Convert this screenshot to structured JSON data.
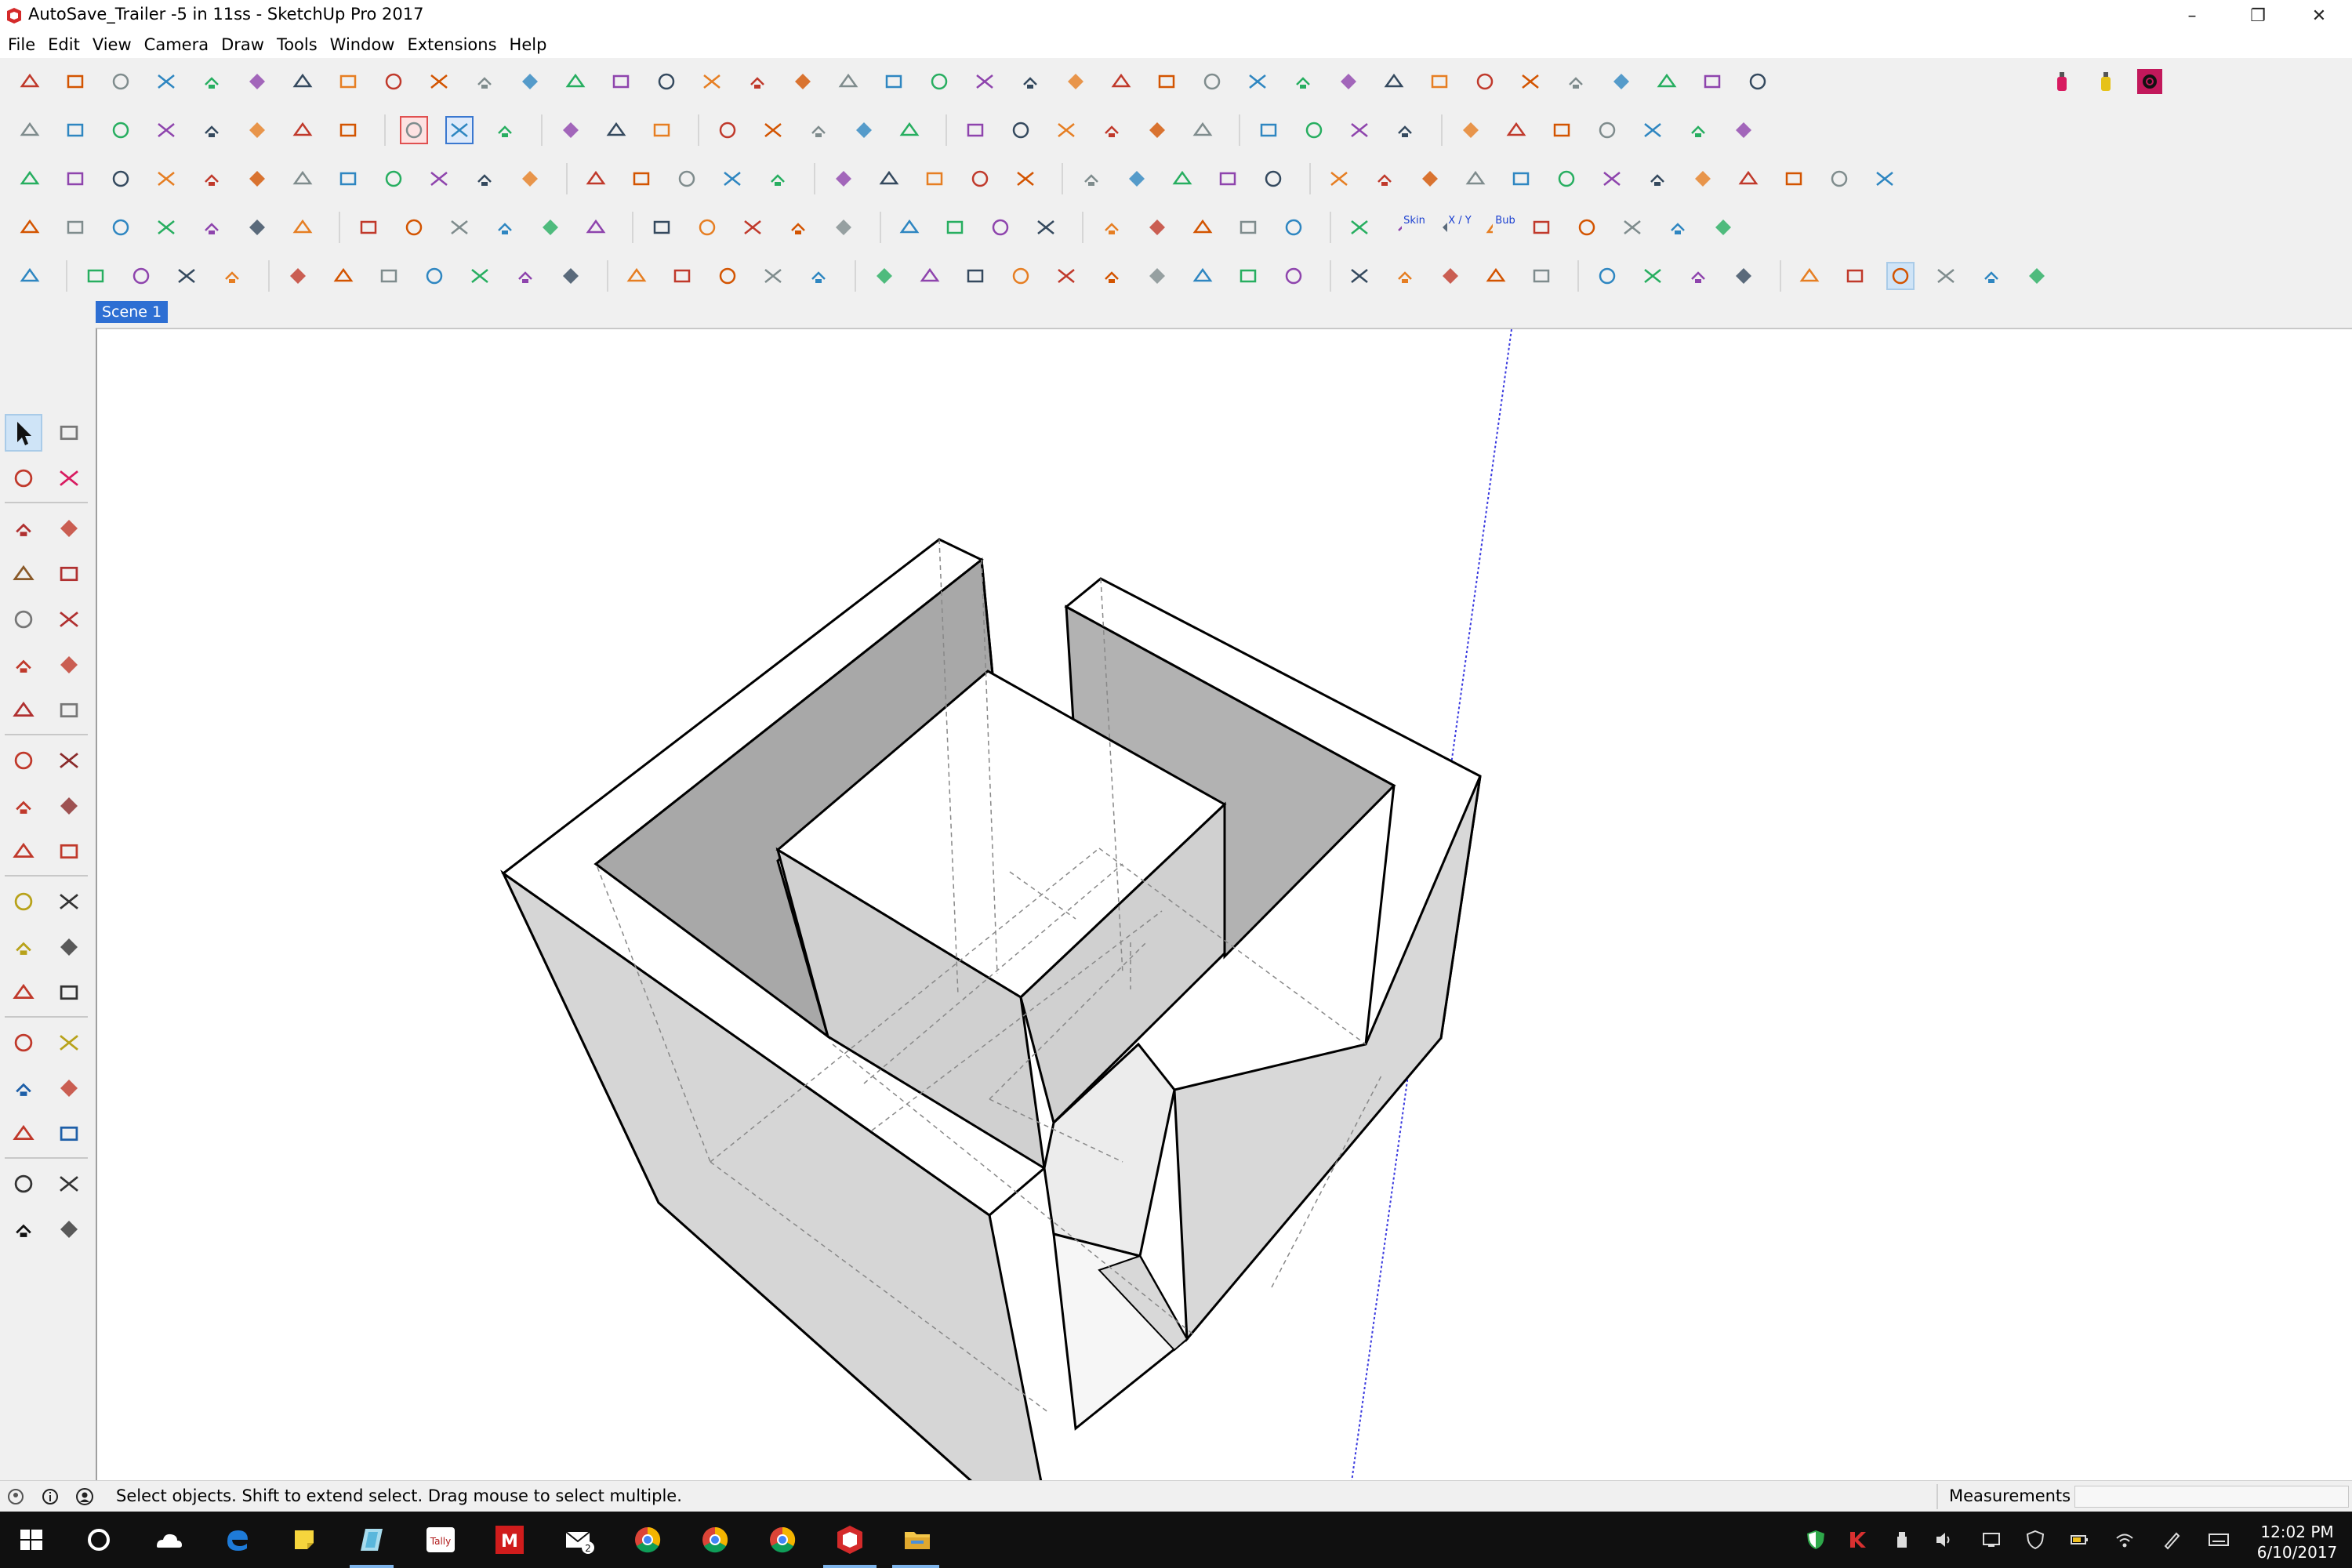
{
  "window": {
    "title": "AutoSave_Trailer -5 in 11ss - SketchUp Pro 2017",
    "controls": [
      "minimize",
      "restore",
      "close"
    ],
    "control_glyphs": [
      "–",
      "❐",
      "✕"
    ]
  },
  "menu": [
    "File",
    "Edit",
    "View",
    "Camera",
    "Draw",
    "Tools",
    "Window",
    "Extensions",
    "Help"
  ],
  "scene_tab": {
    "label": "Scene 1"
  },
  "toolbars": {
    "row1_icon_count": 39,
    "row2_icon_count": 36,
    "row3_icon_count": 40,
    "row4_icon_count": 36,
    "row5_icon_count": 42,
    "row1_right": [
      "red-paint-spray-icon",
      "yellow-paint-spray-icon",
      "gear-settings-icon"
    ],
    "row4_text_buttons": [
      "Skin",
      "X / Y",
      "Bub"
    ],
    "row5_selected": "white-cube-style-icon"
  },
  "left_tools": [
    "select-tool",
    "component-tool",
    "paint-bucket-tool",
    "eraser-tool",
    "pencil-tool",
    "freehand-tool",
    "rectangle-tool",
    "rotated-rectangle-tool",
    "circle-tool",
    "polygon-tool",
    "arc-tool",
    "2-point-arc-tool",
    "3-point-arc-tool",
    "pie-tool",
    "move-tool",
    "push-pull-tool",
    "rotate-tool",
    "follow-me-tool",
    "scale-tool",
    "offset-tool",
    "tape-measure-tool",
    "dimension-tool",
    "protractor-tool",
    "text-tool",
    "axes-tool",
    "3d-text-tool",
    "orbit-tool",
    "pan-tool",
    "zoom-tool",
    "zoom-window-tool",
    "zoom-extents-tool",
    "previous-view-tool",
    "position-camera-tool",
    "look-around-tool",
    "walk-tool",
    "section-plane-tool"
  ],
  "status": {
    "message": "Select objects. Shift to extend select. Drag mouse to select multiple.",
    "measurements_label": "Measurements",
    "measurements_value": ""
  },
  "taskbar": {
    "apps": [
      "start-icon",
      "cortana-icon",
      "onedrive-icon",
      "edge-icon",
      "sticky-notes-icon",
      "glass-app-icon",
      "tally-icon",
      "m-app-icon",
      "mail-icon",
      "chrome-icon",
      "chrome-icon-2",
      "chrome-icon-3",
      "sketchup-icon",
      "file-explorer-icon"
    ],
    "tally_label": "Tally",
    "m_label": "M",
    "mail_badge": "2",
    "tray": [
      "shield-tray-icon",
      "kaspersky-tray-icon",
      "usb-tray-icon",
      "volume-tray-icon",
      "network-tray-icon",
      "security-tray-icon",
      "power-tray-icon",
      "wifi-tray-icon",
      "pen-tray-icon",
      "keyboard-tray-icon"
    ],
    "time": "12:02 PM",
    "date": "6/10/2017"
  }
}
